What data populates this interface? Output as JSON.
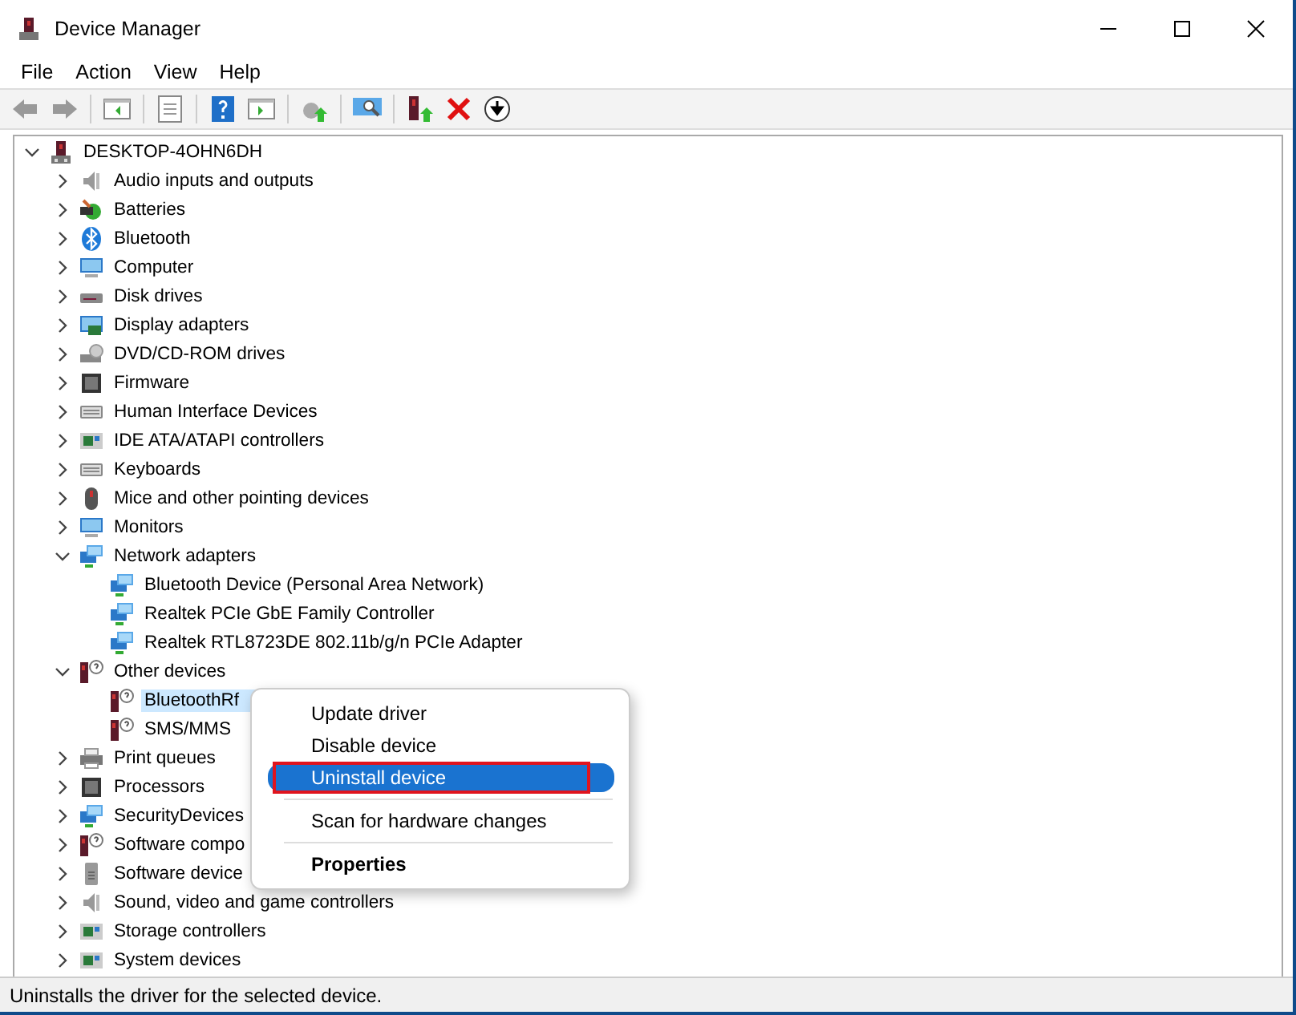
{
  "window": {
    "title": "Device Manager"
  },
  "menu_bar": [
    "File",
    "Action",
    "View",
    "Help"
  ],
  "tree": {
    "label": "DESKTOP-4OHN6DH",
    "expanded": true,
    "selected": false,
    "children": [
      {
        "label": "Audio inputs and outputs",
        "expanded": false,
        "selected": false
      },
      {
        "label": "Batteries",
        "expanded": false,
        "selected": false
      },
      {
        "label": "Bluetooth",
        "expanded": false,
        "selected": false
      },
      {
        "label": "Computer",
        "expanded": false,
        "selected": false
      },
      {
        "label": "Disk drives",
        "expanded": false,
        "selected": false
      },
      {
        "label": "Display adapters",
        "expanded": false,
        "selected": false
      },
      {
        "label": "DVD/CD-ROM drives",
        "expanded": false,
        "selected": false
      },
      {
        "label": "Firmware",
        "expanded": false,
        "selected": false
      },
      {
        "label": "Human Interface Devices",
        "expanded": false,
        "selected": false
      },
      {
        "label": "IDE ATA/ATAPI controllers",
        "expanded": false,
        "selected": false
      },
      {
        "label": "Keyboards",
        "expanded": false,
        "selected": false
      },
      {
        "label": "Mice and other pointing devices",
        "expanded": false,
        "selected": false
      },
      {
        "label": "Monitors",
        "expanded": false,
        "selected": false
      },
      {
        "label": "Network adapters",
        "expanded": true,
        "selected": false,
        "children": [
          {
            "label": "Bluetooth Device (Personal Area Network)",
            "selected": false
          },
          {
            "label": "Realtek PCIe GbE Family Controller",
            "selected": false
          },
          {
            "label": "Realtek RTL8723DE 802.11b/g/n PCIe Adapter",
            "selected": false
          }
        ]
      },
      {
        "label": "Other devices",
        "expanded": true,
        "selected": false,
        "children": [
          {
            "label": "BluetoothRf",
            "selected": true
          },
          {
            "label": "SMS/MMS",
            "selected": false
          }
        ]
      },
      {
        "label": "Print queues",
        "expanded": false,
        "selected": false
      },
      {
        "label": "Processors",
        "expanded": false,
        "selected": false
      },
      {
        "label": "SecurityDevices",
        "expanded": false,
        "selected": false
      },
      {
        "label": "Software compo",
        "expanded": false,
        "selected": false
      },
      {
        "label": "Software device",
        "expanded": false,
        "selected": false
      },
      {
        "label": "Sound, video and game controllers",
        "expanded": false,
        "selected": false
      },
      {
        "label": "Storage controllers",
        "expanded": false,
        "selected": false
      },
      {
        "label": "System devices",
        "expanded": false,
        "selected": false
      }
    ]
  },
  "context_menu": {
    "items": [
      {
        "kind": "item",
        "label": "Update driver",
        "selected": false,
        "annotated": false
      },
      {
        "kind": "item",
        "label": "Disable device",
        "selected": false,
        "annotated": false
      },
      {
        "kind": "item",
        "label": "Uninstall device",
        "selected": true,
        "annotated": true
      },
      {
        "kind": "separator"
      },
      {
        "kind": "item",
        "label": "Scan for hardware changes",
        "selected": false,
        "annotated": false
      },
      {
        "kind": "separator"
      },
      {
        "kind": "default",
        "label": "Properties",
        "selected": false,
        "annotated": false
      }
    ]
  },
  "status_bar": {
    "text": "Uninstalls the driver for the selected device."
  }
}
